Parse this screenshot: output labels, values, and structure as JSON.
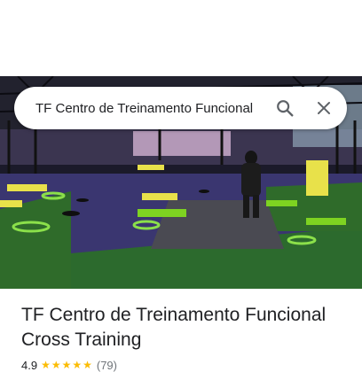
{
  "search": {
    "query": "TF Centro de Treinamento Funcional"
  },
  "place": {
    "name": "TF Centro de Treinamento Funcional Cross Training",
    "rating": "4.9",
    "stars": "★★★★★",
    "review_count": "(79)"
  },
  "icons": {
    "search": "search-icon",
    "close": "close-icon"
  },
  "colors": {
    "accent_star": "#fbbc04",
    "icon_gray": "#5f6368",
    "turf_green": "#2f6b2a",
    "floor_purple": "#3a3670"
  }
}
